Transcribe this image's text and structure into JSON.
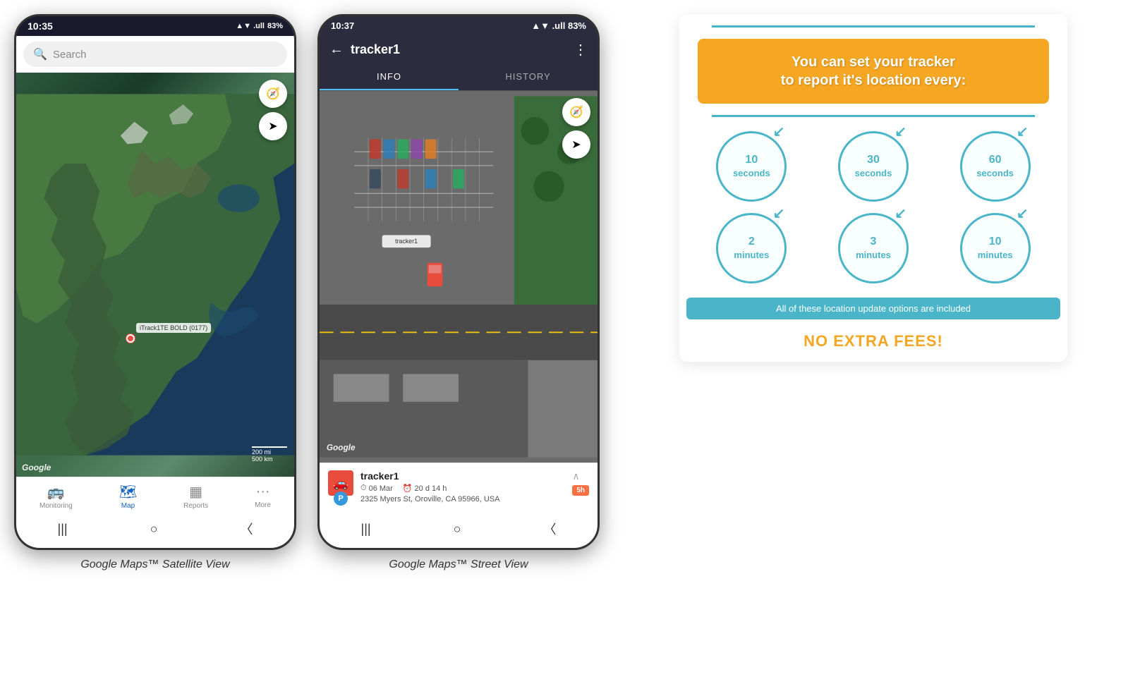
{
  "left_phone": {
    "status_bar": {
      "time": "10:35",
      "signal": "▲▼ .ull",
      "battery": "83%"
    },
    "search": {
      "placeholder": "Search"
    },
    "map": {
      "tracker_label": "iTrack1TE BOLD (0177)",
      "google_label": "Google",
      "scale_200mi": "200 mi",
      "scale_500km": "500 km"
    },
    "nav": {
      "items": [
        {
          "label": "Monitoring",
          "icon": "🚌",
          "active": false
        },
        {
          "label": "Map",
          "icon": "🗺",
          "active": true
        },
        {
          "label": "Reports",
          "icon": "▦",
          "active": false
        },
        {
          "label": "More",
          "icon": "···",
          "active": false
        }
      ]
    },
    "caption": "Google Maps™ Satellite View"
  },
  "right_phone": {
    "status_bar": {
      "time": "10:37",
      "signal": "▲▼ .ull",
      "battery": "83%"
    },
    "header": {
      "back_icon": "←",
      "title": "tracker1",
      "menu_icon": "⋮"
    },
    "tabs": [
      {
        "label": "INFO",
        "active": true
      },
      {
        "label": "HISTORY",
        "active": false
      }
    ],
    "map": {
      "google_label": "Google",
      "tracker_label": "tracker1"
    },
    "info_card": {
      "tracker_name": "tracker1",
      "parking": "P",
      "date": "06 Mar",
      "duration": "20 d 14 h",
      "address": "2325 Myers St, Oroville, CA 95966, USA",
      "time_badge": "5h"
    },
    "caption": "Google Maps™ Street View"
  },
  "info_panel": {
    "header_text": "You can set your tracker\nto report it's location every:",
    "circles": [
      {
        "value": "10\nseconds"
      },
      {
        "value": "30\nseconds"
      },
      {
        "value": "60\nseconds"
      },
      {
        "value": "2\nminutes"
      },
      {
        "value": "3\nminutes"
      },
      {
        "value": "10\nminutes"
      }
    ],
    "footer_text": "All of these location update options are included",
    "no_fees_text": "NO EXTRA FEES!"
  }
}
